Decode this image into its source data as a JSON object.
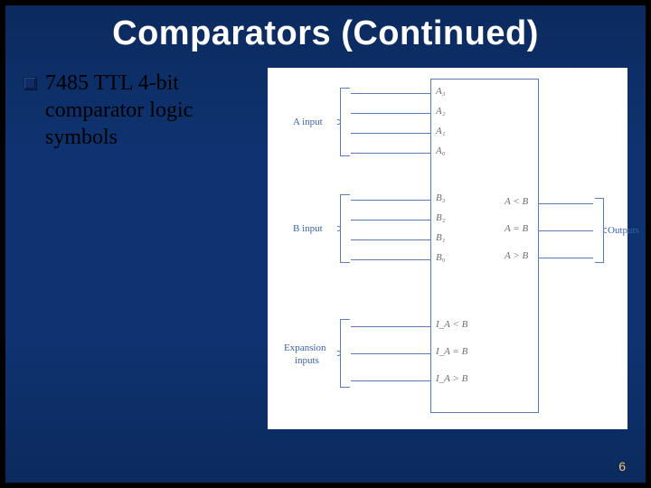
{
  "title": "Comparators (Continued)",
  "bullet": "7485 TTL 4-bit comparator logic symbols",
  "page_number": "6",
  "figure": {
    "a_input_label": "A input",
    "b_input_label": "B input",
    "expansion_label_line1": "Expansion",
    "expansion_label_line2": "inputs",
    "outputs_label": "Outputs",
    "pins_a": [
      "A₃",
      "A₂",
      "A₁",
      "A₀"
    ],
    "pins_b": [
      "B₃",
      "B₂",
      "B₁",
      "B₀"
    ],
    "pins_exp": [
      "I_A < B",
      "I_A = B",
      "I_A > B"
    ],
    "pins_out": [
      "A < B",
      "A = B",
      "A > B"
    ]
  }
}
